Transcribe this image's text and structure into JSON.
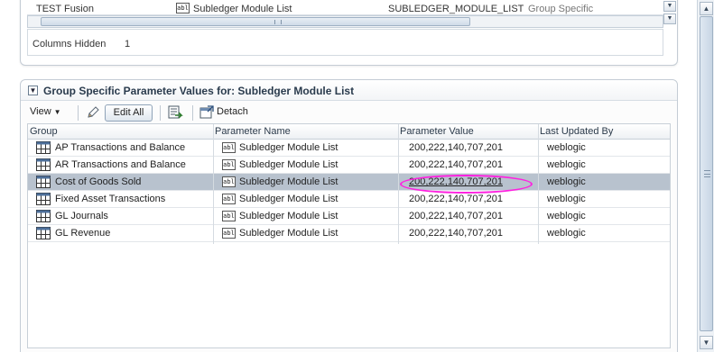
{
  "top_table": {
    "row": {
      "group": "TEST Fusion",
      "param_name": "Subledger Module List",
      "param_value": "SUBLEDGER_MODULE_LIST",
      "type": "Group Specific"
    },
    "icon_label": "abl",
    "columns_hidden_label": "Columns Hidden",
    "columns_hidden_value": "1"
  },
  "panel": {
    "title": "Group Specific Parameter Values for: Subledger Module List"
  },
  "toolbar": {
    "view_label": "View",
    "edit_all_label": "Edit All",
    "detach_label": "Detach"
  },
  "grid": {
    "headers": [
      "Group",
      "Parameter Name",
      "Parameter Value",
      "Last Updated By"
    ],
    "icon_label": "abl",
    "rows": [
      {
        "group": "AP Transactions and Balance",
        "param_name": "Subledger Module List",
        "param_value": "200,222,140,707,201",
        "updated_by": "weblogic",
        "selected": false
      },
      {
        "group": "AR Transactions and Balance",
        "param_name": "Subledger Module List",
        "param_value": "200,222,140,707,201",
        "updated_by": "weblogic",
        "selected": false
      },
      {
        "group": "Cost of Goods Sold",
        "param_name": "Subledger Module List",
        "param_value": "200,222,140,707,201",
        "updated_by": "weblogic",
        "selected": true
      },
      {
        "group": "Fixed Asset Transactions",
        "param_name": "Subledger Module List",
        "param_value": "200,222,140,707,201",
        "updated_by": "weblogic",
        "selected": false
      },
      {
        "group": "GL Journals",
        "param_name": "Subledger Module List",
        "param_value": "200,222,140,707,201",
        "updated_by": "weblogic",
        "selected": false
      },
      {
        "group": "GL Revenue",
        "param_name": "Subledger Module List",
        "param_value": "200,222,140,707,201",
        "updated_by": "weblogic",
        "selected": false
      }
    ]
  },
  "colors": {
    "selected_row": "#b8c2ce",
    "highlight_ellipse": "#ff20e0",
    "link": "#1a3f8f"
  }
}
